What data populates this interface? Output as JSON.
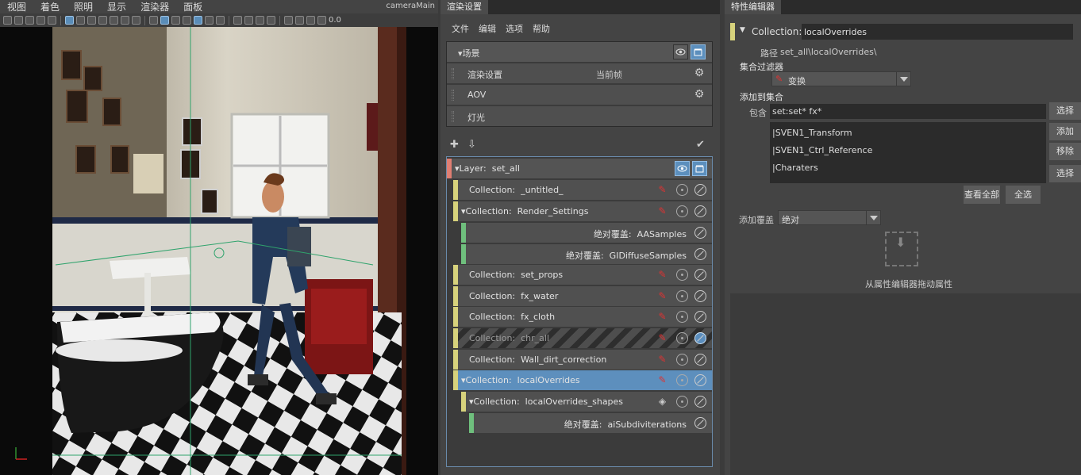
{
  "viewport": {
    "menu": [
      "视图",
      "着色",
      "照明",
      "显示",
      "渲染器",
      "面板"
    ],
    "camera_name": "cameraMain",
    "toolbar_value": "0.0"
  },
  "render_panel": {
    "tab_title": "渲染设置",
    "menu": [
      "文件",
      "编辑",
      "选项",
      "帮助"
    ],
    "scene": {
      "header": "场景",
      "rows": [
        {
          "label": "渲染设置",
          "value": "当前帧"
        },
        {
          "label": "AOV",
          "value": ""
        },
        {
          "label": "灯光",
          "value": ""
        }
      ]
    },
    "layer": {
      "prefix": "Layer:",
      "name": "set_all"
    },
    "collections": [
      {
        "kind": "collection",
        "prefix": "Collection:",
        "name": "_untitled_"
      },
      {
        "kind": "collection",
        "prefix": "Collection:",
        "name": "Render_Settings",
        "expanded": true
      },
      {
        "kind": "override",
        "prefix": "绝对覆盖:",
        "name": "AASamples"
      },
      {
        "kind": "override",
        "prefix": "绝对覆盖:",
        "name": "GIDiffuseSamples"
      },
      {
        "kind": "collection",
        "prefix": "Collection:",
        "name": "set_props"
      },
      {
        "kind": "collection",
        "prefix": "Collection:",
        "name": "fx_water"
      },
      {
        "kind": "collection",
        "prefix": "Collection:",
        "name": "fx_cloth"
      },
      {
        "kind": "collection",
        "prefix": "Collection:",
        "name": "chr_all",
        "disabled": true
      },
      {
        "kind": "collection",
        "prefix": "Collection:",
        "name": "Wall_dirt_correction"
      },
      {
        "kind": "collection",
        "prefix": "Collection:",
        "name": "localOverrides",
        "expanded": true,
        "selected": true
      },
      {
        "kind": "subcollection",
        "prefix": "Collection:",
        "name": "localOverrides_shapes",
        "expanded": true
      },
      {
        "kind": "suboverride",
        "prefix": "绝对覆盖:",
        "name": "aiSubdiviterations"
      }
    ]
  },
  "attr_panel": {
    "tab_title": "特性编辑器",
    "collection_label": "Collection:",
    "collection_name": "localOverrides",
    "path_label": "路径",
    "path_value": "set_all\\localOverrides\\",
    "filter_heading": "集合过滤器",
    "filter_value": "变换",
    "add_to_collection_heading": "添加到集合",
    "include_label": "包含",
    "include_value": "set:set* fx*",
    "members": [
      "|SVEN1_Transform",
      "|SVEN1_Ctrl_Reference",
      "|Charaters"
    ],
    "side_buttons": [
      "选择",
      "添加",
      "移除",
      "选择"
    ],
    "view_all_button": "查看全部",
    "select_all_button": "全选",
    "add_override_label": "添加覆盖",
    "add_override_value": "绝对",
    "drop_hint": "从属性编辑器拖动属性"
  },
  "colors": {
    "selected": "#5d8fbd",
    "collection_bar": "#d7d27c",
    "override_bar": "#6fbf7d",
    "layer_bar": "#e07e72"
  }
}
